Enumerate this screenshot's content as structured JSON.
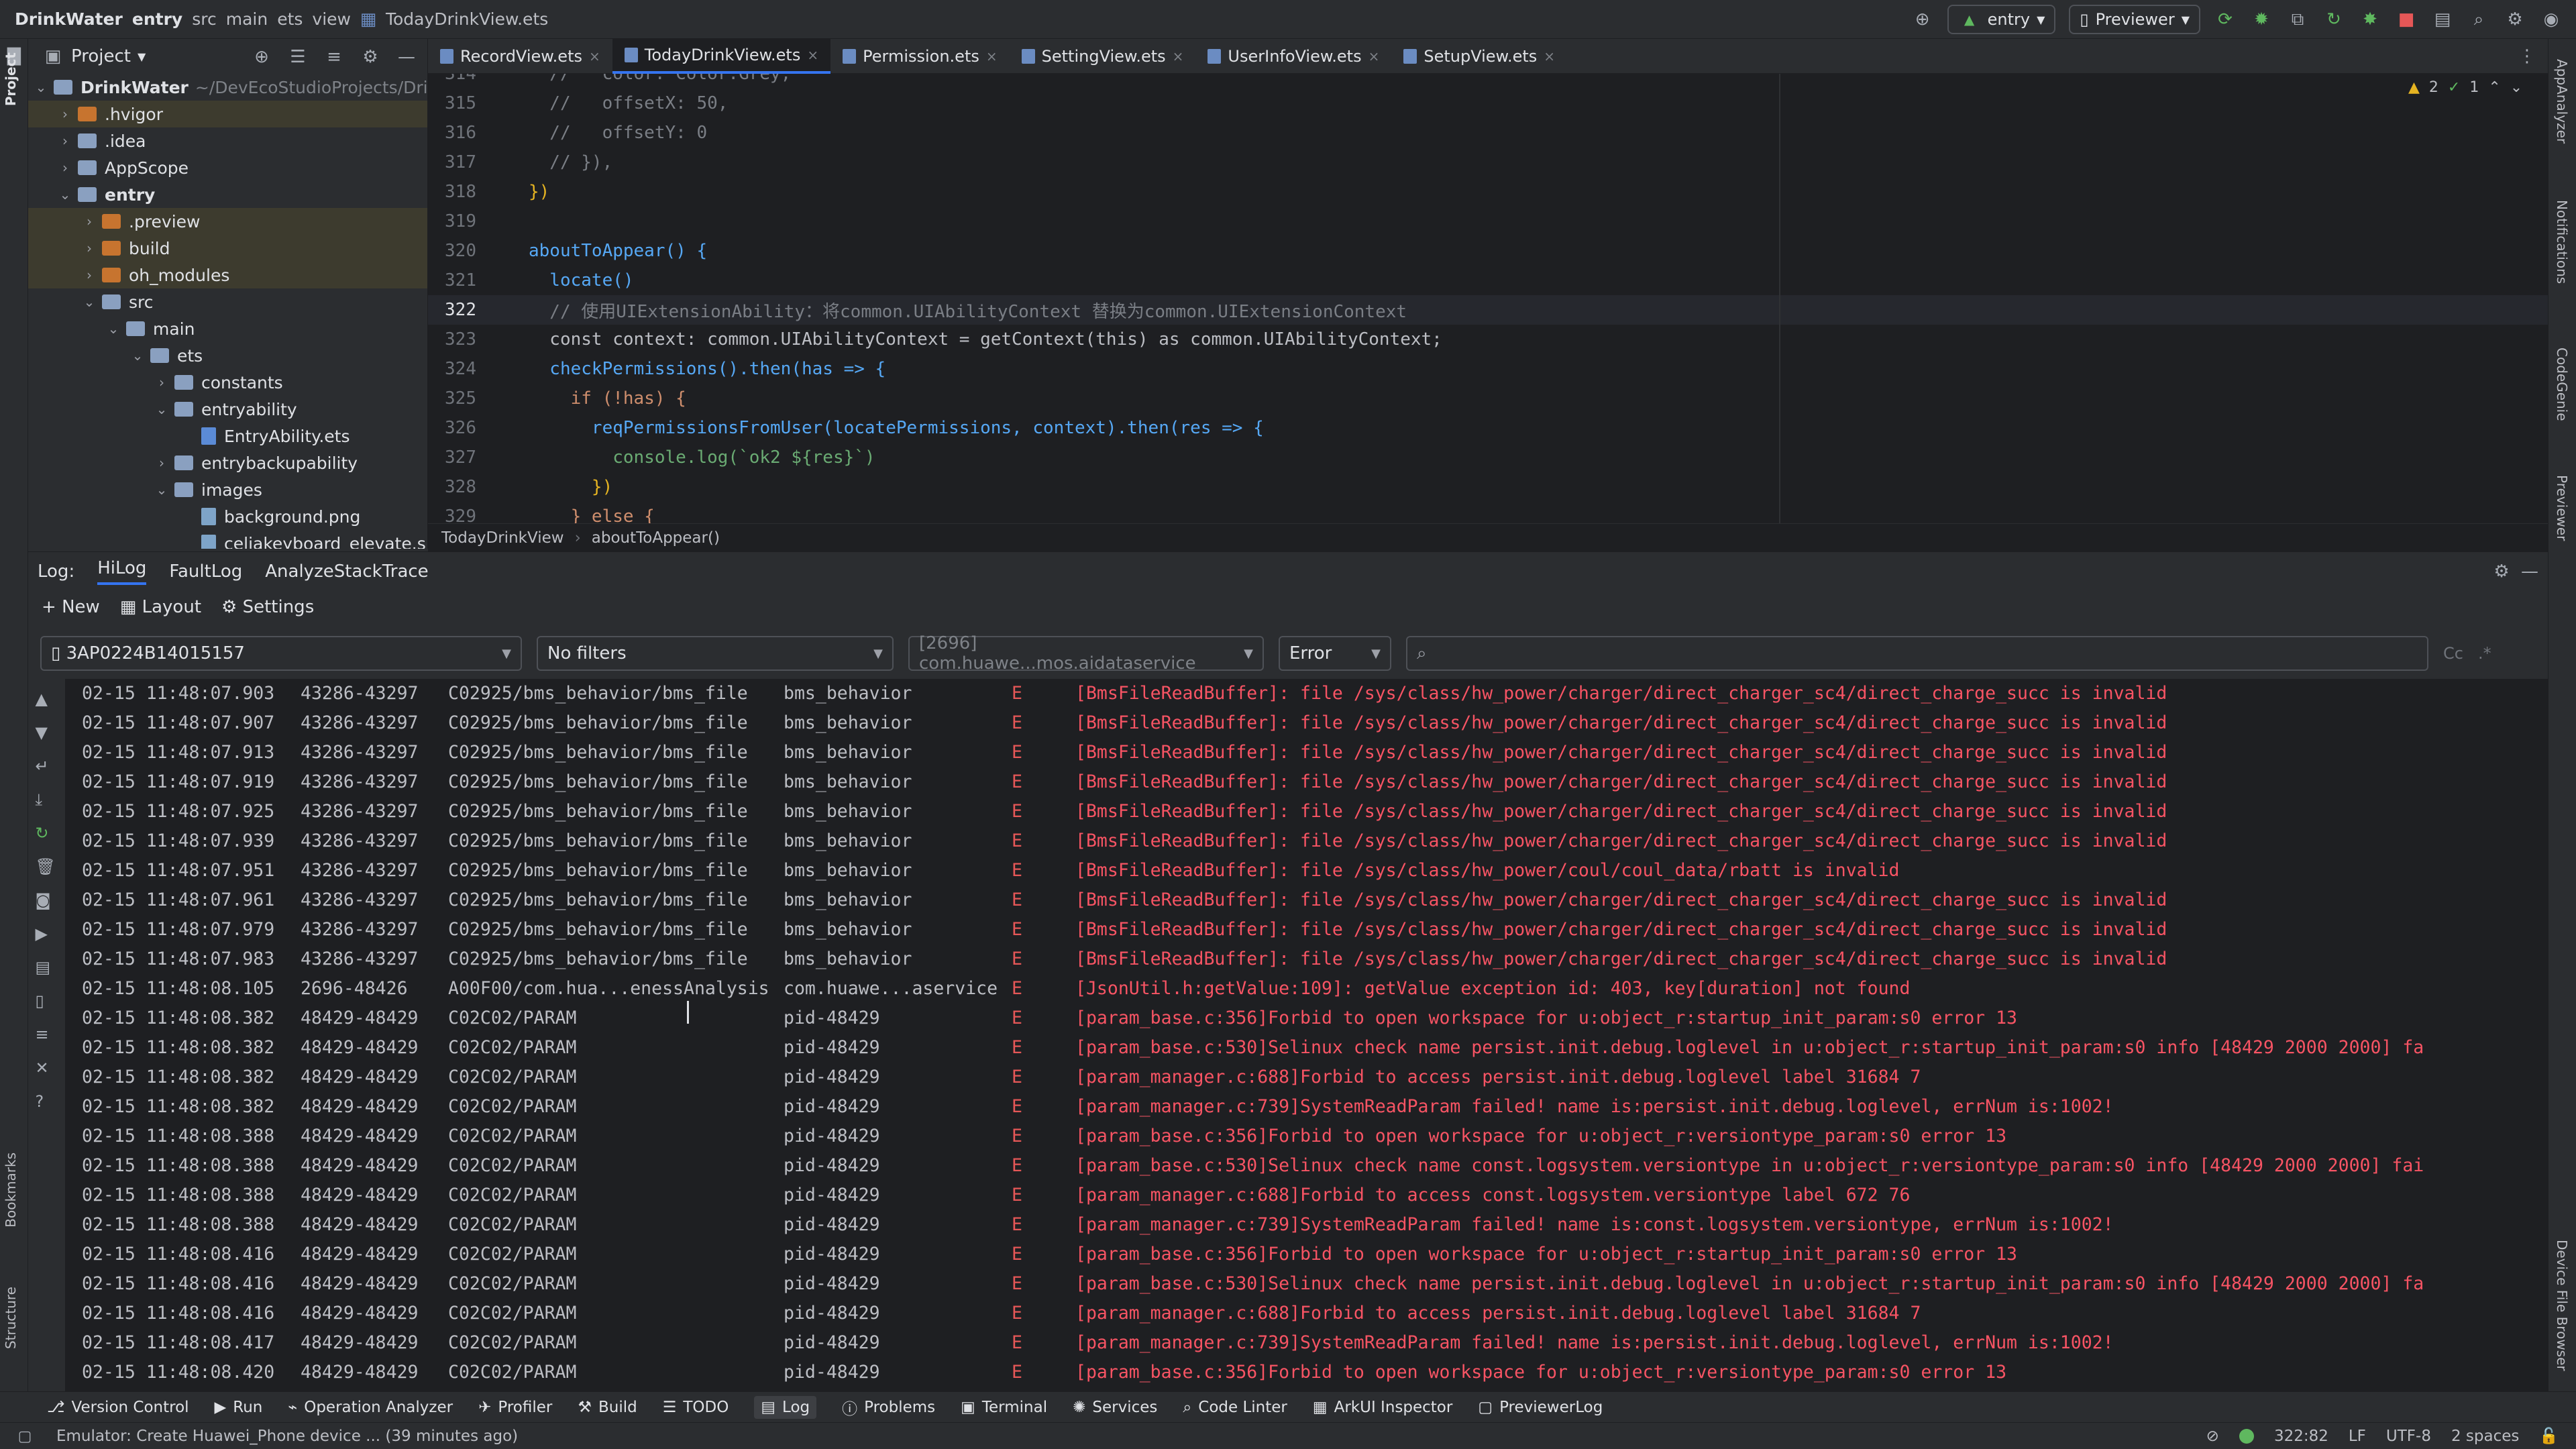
{
  "topbar": {
    "breadcrumb": [
      "DrinkWater",
      "entry",
      "src",
      "main",
      "ets",
      "view",
      "TodayDrinkView.ets"
    ],
    "module_selector": "entry",
    "previewer_label": "Previewer"
  },
  "left_stripe": {
    "project": "Project",
    "bookmarks": "Bookmarks",
    "structure": "Structure"
  },
  "right_stripe": {
    "app_analyzer": "AppAnalyzer",
    "notifications": "Notifications",
    "codegenie": "CodeGenie",
    "previewer": "Previewer",
    "device_file_browser": "Device File Browser"
  },
  "project_panel": {
    "title": "Project",
    "tree": [
      {
        "label": "DrinkWater",
        "extra": "~/DevEcoStudioProjects/Dri",
        "bold": true
      },
      {
        "label": ".hvigor"
      },
      {
        "label": ".idea"
      },
      {
        "label": "AppScope"
      },
      {
        "label": "entry",
        "bold": true
      },
      {
        "label": ".preview"
      },
      {
        "label": "build"
      },
      {
        "label": "oh_modules"
      },
      {
        "label": "src"
      },
      {
        "label": "main"
      },
      {
        "label": "ets"
      },
      {
        "label": "constants"
      },
      {
        "label": "entryability"
      },
      {
        "label": "EntryAbility.ets"
      },
      {
        "label": "entrybackupability"
      },
      {
        "label": "images"
      },
      {
        "label": "background.png"
      },
      {
        "label": "celiakeyboard_elevate.s"
      }
    ]
  },
  "tabs": [
    "RecordView.ets",
    "TodayDrinkView.ets",
    "Permission.ets",
    "SettingView.ets",
    "UserInfoView.ets",
    "SetupView.ets"
  ],
  "editor": {
    "inspection": {
      "warnings": "2",
      "ok": "1"
    },
    "line_numbers": [
      "314",
      "315",
      "316",
      "317",
      "318",
      "319",
      "320",
      "321",
      "322",
      "323",
      "324",
      "325",
      "326",
      "327",
      "328",
      "329"
    ],
    "lines": [
      "  //   color: Color.Grey,",
      "  //   offsetX: 50,",
      "  //   offsetY: 0",
      "  // }),",
      "})",
      "",
      "aboutToAppear() {",
      "  locate()",
      "  // 使用UIExtensionAbility：将common.UIAbilityContext 替换为common.UIExtensionContext",
      "  const context: common.UIAbilityContext = getContext(this) as common.UIAbilityContext;",
      "  checkPermissions().then(has => {",
      "    if (!has) {",
      "      reqPermissionsFromUser(locatePermissions, context).then(res => {",
      "        console.log(`ok2 ${res}`)",
      "      })",
      "    } else {"
    ],
    "breadcrumb": [
      "TodayDrinkView",
      "aboutToAppear()"
    ]
  },
  "log": {
    "label": "Log:",
    "tabs": [
      "HiLog",
      "FaultLog",
      "AnalyzeStackTrace"
    ],
    "toolbar": {
      "new": "New",
      "layout": "Layout",
      "settings": "Settings"
    },
    "filters": {
      "device": "3AP0224B14015157",
      "filter": "No filters",
      "process": "[2696] com.huawe...mos.aidataservice",
      "level": "Error",
      "search_case": "Cc",
      "search_regex": ".*"
    },
    "rows": [
      [
        "02-15 11:48:07.903",
        "43286-43297",
        "C02925/bms_behavior/bms_file",
        "bms_behavior",
        "E",
        "[BmsFileReadBuffer]: file /sys/class/hw_power/charger/direct_charger_sc4/direct_charge_succ is invalid"
      ],
      [
        "02-15 11:48:07.907",
        "43286-43297",
        "C02925/bms_behavior/bms_file",
        "bms_behavior",
        "E",
        "[BmsFileReadBuffer]: file /sys/class/hw_power/charger/direct_charger_sc4/direct_charge_succ is invalid"
      ],
      [
        "02-15 11:48:07.913",
        "43286-43297",
        "C02925/bms_behavior/bms_file",
        "bms_behavior",
        "E",
        "[BmsFileReadBuffer]: file /sys/class/hw_power/charger/direct_charger_sc4/direct_charge_succ is invalid"
      ],
      [
        "02-15 11:48:07.919",
        "43286-43297",
        "C02925/bms_behavior/bms_file",
        "bms_behavior",
        "E",
        "[BmsFileReadBuffer]: file /sys/class/hw_power/charger/direct_charger_sc4/direct_charge_succ is invalid"
      ],
      [
        "02-15 11:48:07.925",
        "43286-43297",
        "C02925/bms_behavior/bms_file",
        "bms_behavior",
        "E",
        "[BmsFileReadBuffer]: file /sys/class/hw_power/charger/direct_charger_sc4/direct_charge_succ is invalid"
      ],
      [
        "02-15 11:48:07.939",
        "43286-43297",
        "C02925/bms_behavior/bms_file",
        "bms_behavior",
        "E",
        "[BmsFileReadBuffer]: file /sys/class/hw_power/charger/direct_charger_sc4/direct_charge_succ is invalid"
      ],
      [
        "02-15 11:48:07.951",
        "43286-43297",
        "C02925/bms_behavior/bms_file",
        "bms_behavior",
        "E",
        "[BmsFileReadBuffer]: file /sys/class/hw_power/coul/coul_data/rbatt is invalid"
      ],
      [
        "02-15 11:48:07.961",
        "43286-43297",
        "C02925/bms_behavior/bms_file",
        "bms_behavior",
        "E",
        "[BmsFileReadBuffer]: file /sys/class/hw_power/charger/direct_charger_sc4/direct_charge_succ is invalid"
      ],
      [
        "02-15 11:48:07.979",
        "43286-43297",
        "C02925/bms_behavior/bms_file",
        "bms_behavior",
        "E",
        "[BmsFileReadBuffer]: file /sys/class/hw_power/charger/direct_charger_sc4/direct_charge_succ is invalid"
      ],
      [
        "02-15 11:48:07.983",
        "43286-43297",
        "C02925/bms_behavior/bms_file",
        "bms_behavior",
        "E",
        "[BmsFileReadBuffer]: file /sys/class/hw_power/charger/direct_charger_sc4/direct_charge_succ is invalid"
      ],
      [
        "02-15 11:48:08.105",
        "2696-48426",
        "A00F00/com.hua...enessAnalysis",
        "com.huawe...aservice",
        "E",
        "[JsonUtil.h:getValue:109]: getValue exception id: 403, key[duration] not found"
      ],
      [
        "02-15 11:48:08.382",
        "48429-48429",
        "C02C02/PARAM",
        "pid-48429",
        "E",
        "[param_base.c:356]Forbid to open workspace for u:object_r:startup_init_param:s0 error 13"
      ],
      [
        "02-15 11:48:08.382",
        "48429-48429",
        "C02C02/PARAM",
        "pid-48429",
        "E",
        "[param_base.c:530]Selinux check name persist.init.debug.loglevel in u:object_r:startup_init_param:s0 info [48429 2000 2000] fa"
      ],
      [
        "02-15 11:48:08.382",
        "48429-48429",
        "C02C02/PARAM",
        "pid-48429",
        "E",
        "[param_manager.c:688]Forbid to access persist.init.debug.loglevel label 31684 7"
      ],
      [
        "02-15 11:48:08.382",
        "48429-48429",
        "C02C02/PARAM",
        "pid-48429",
        "E",
        "[param_manager.c:739]SystemReadParam failed! name is:persist.init.debug.loglevel, errNum is:1002!"
      ],
      [
        "02-15 11:48:08.388",
        "48429-48429",
        "C02C02/PARAM",
        "pid-48429",
        "E",
        "[param_base.c:356]Forbid to open workspace for u:object_r:versiontype_param:s0 error 13"
      ],
      [
        "02-15 11:48:08.388",
        "48429-48429",
        "C02C02/PARAM",
        "pid-48429",
        "E",
        "[param_base.c:530]Selinux check name const.logsystem.versiontype in u:object_r:versiontype_param:s0 info [48429 2000 2000] fai"
      ],
      [
        "02-15 11:48:08.388",
        "48429-48429",
        "C02C02/PARAM",
        "pid-48429",
        "E",
        "[param_manager.c:688]Forbid to access const.logsystem.versiontype label 672 76"
      ],
      [
        "02-15 11:48:08.388",
        "48429-48429",
        "C02C02/PARAM",
        "pid-48429",
        "E",
        "[param_manager.c:739]SystemReadParam failed! name is:const.logsystem.versiontype, errNum is:1002!"
      ],
      [
        "02-15 11:48:08.416",
        "48429-48429",
        "C02C02/PARAM",
        "pid-48429",
        "E",
        "[param_base.c:356]Forbid to open workspace for u:object_r:startup_init_param:s0 error 13"
      ],
      [
        "02-15 11:48:08.416",
        "48429-48429",
        "C02C02/PARAM",
        "pid-48429",
        "E",
        "[param_base.c:530]Selinux check name persist.init.debug.loglevel in u:object_r:startup_init_param:s0 info [48429 2000 2000] fa"
      ],
      [
        "02-15 11:48:08.416",
        "48429-48429",
        "C02C02/PARAM",
        "pid-48429",
        "E",
        "[param_manager.c:688]Forbid to access persist.init.debug.loglevel label 31684 7"
      ],
      [
        "02-15 11:48:08.417",
        "48429-48429",
        "C02C02/PARAM",
        "pid-48429",
        "E",
        "[param_manager.c:739]SystemReadParam failed! name is:persist.init.debug.loglevel, errNum is:1002!"
      ],
      [
        "02-15 11:48:08.420",
        "48429-48429",
        "C02C02/PARAM",
        "pid-48429",
        "E",
        "[param_base.c:356]Forbid to open workspace for u:object_r:versiontype_param:s0 error 13"
      ]
    ]
  },
  "bottom_tools": [
    "Version Control",
    "Run",
    "Operation Analyzer",
    "Profiler",
    "Build",
    "TODO",
    "Log",
    "Problems",
    "Terminal",
    "Services",
    "Code Linter",
    "ArkUI Inspector",
    "PreviewerLog"
  ],
  "status": {
    "message": "Emulator: Create Huawei_Phone device ... (39 minutes ago)",
    "position": "322:82",
    "line_ending": "LF",
    "encoding": "UTF-8",
    "indent": "2 spaces"
  }
}
